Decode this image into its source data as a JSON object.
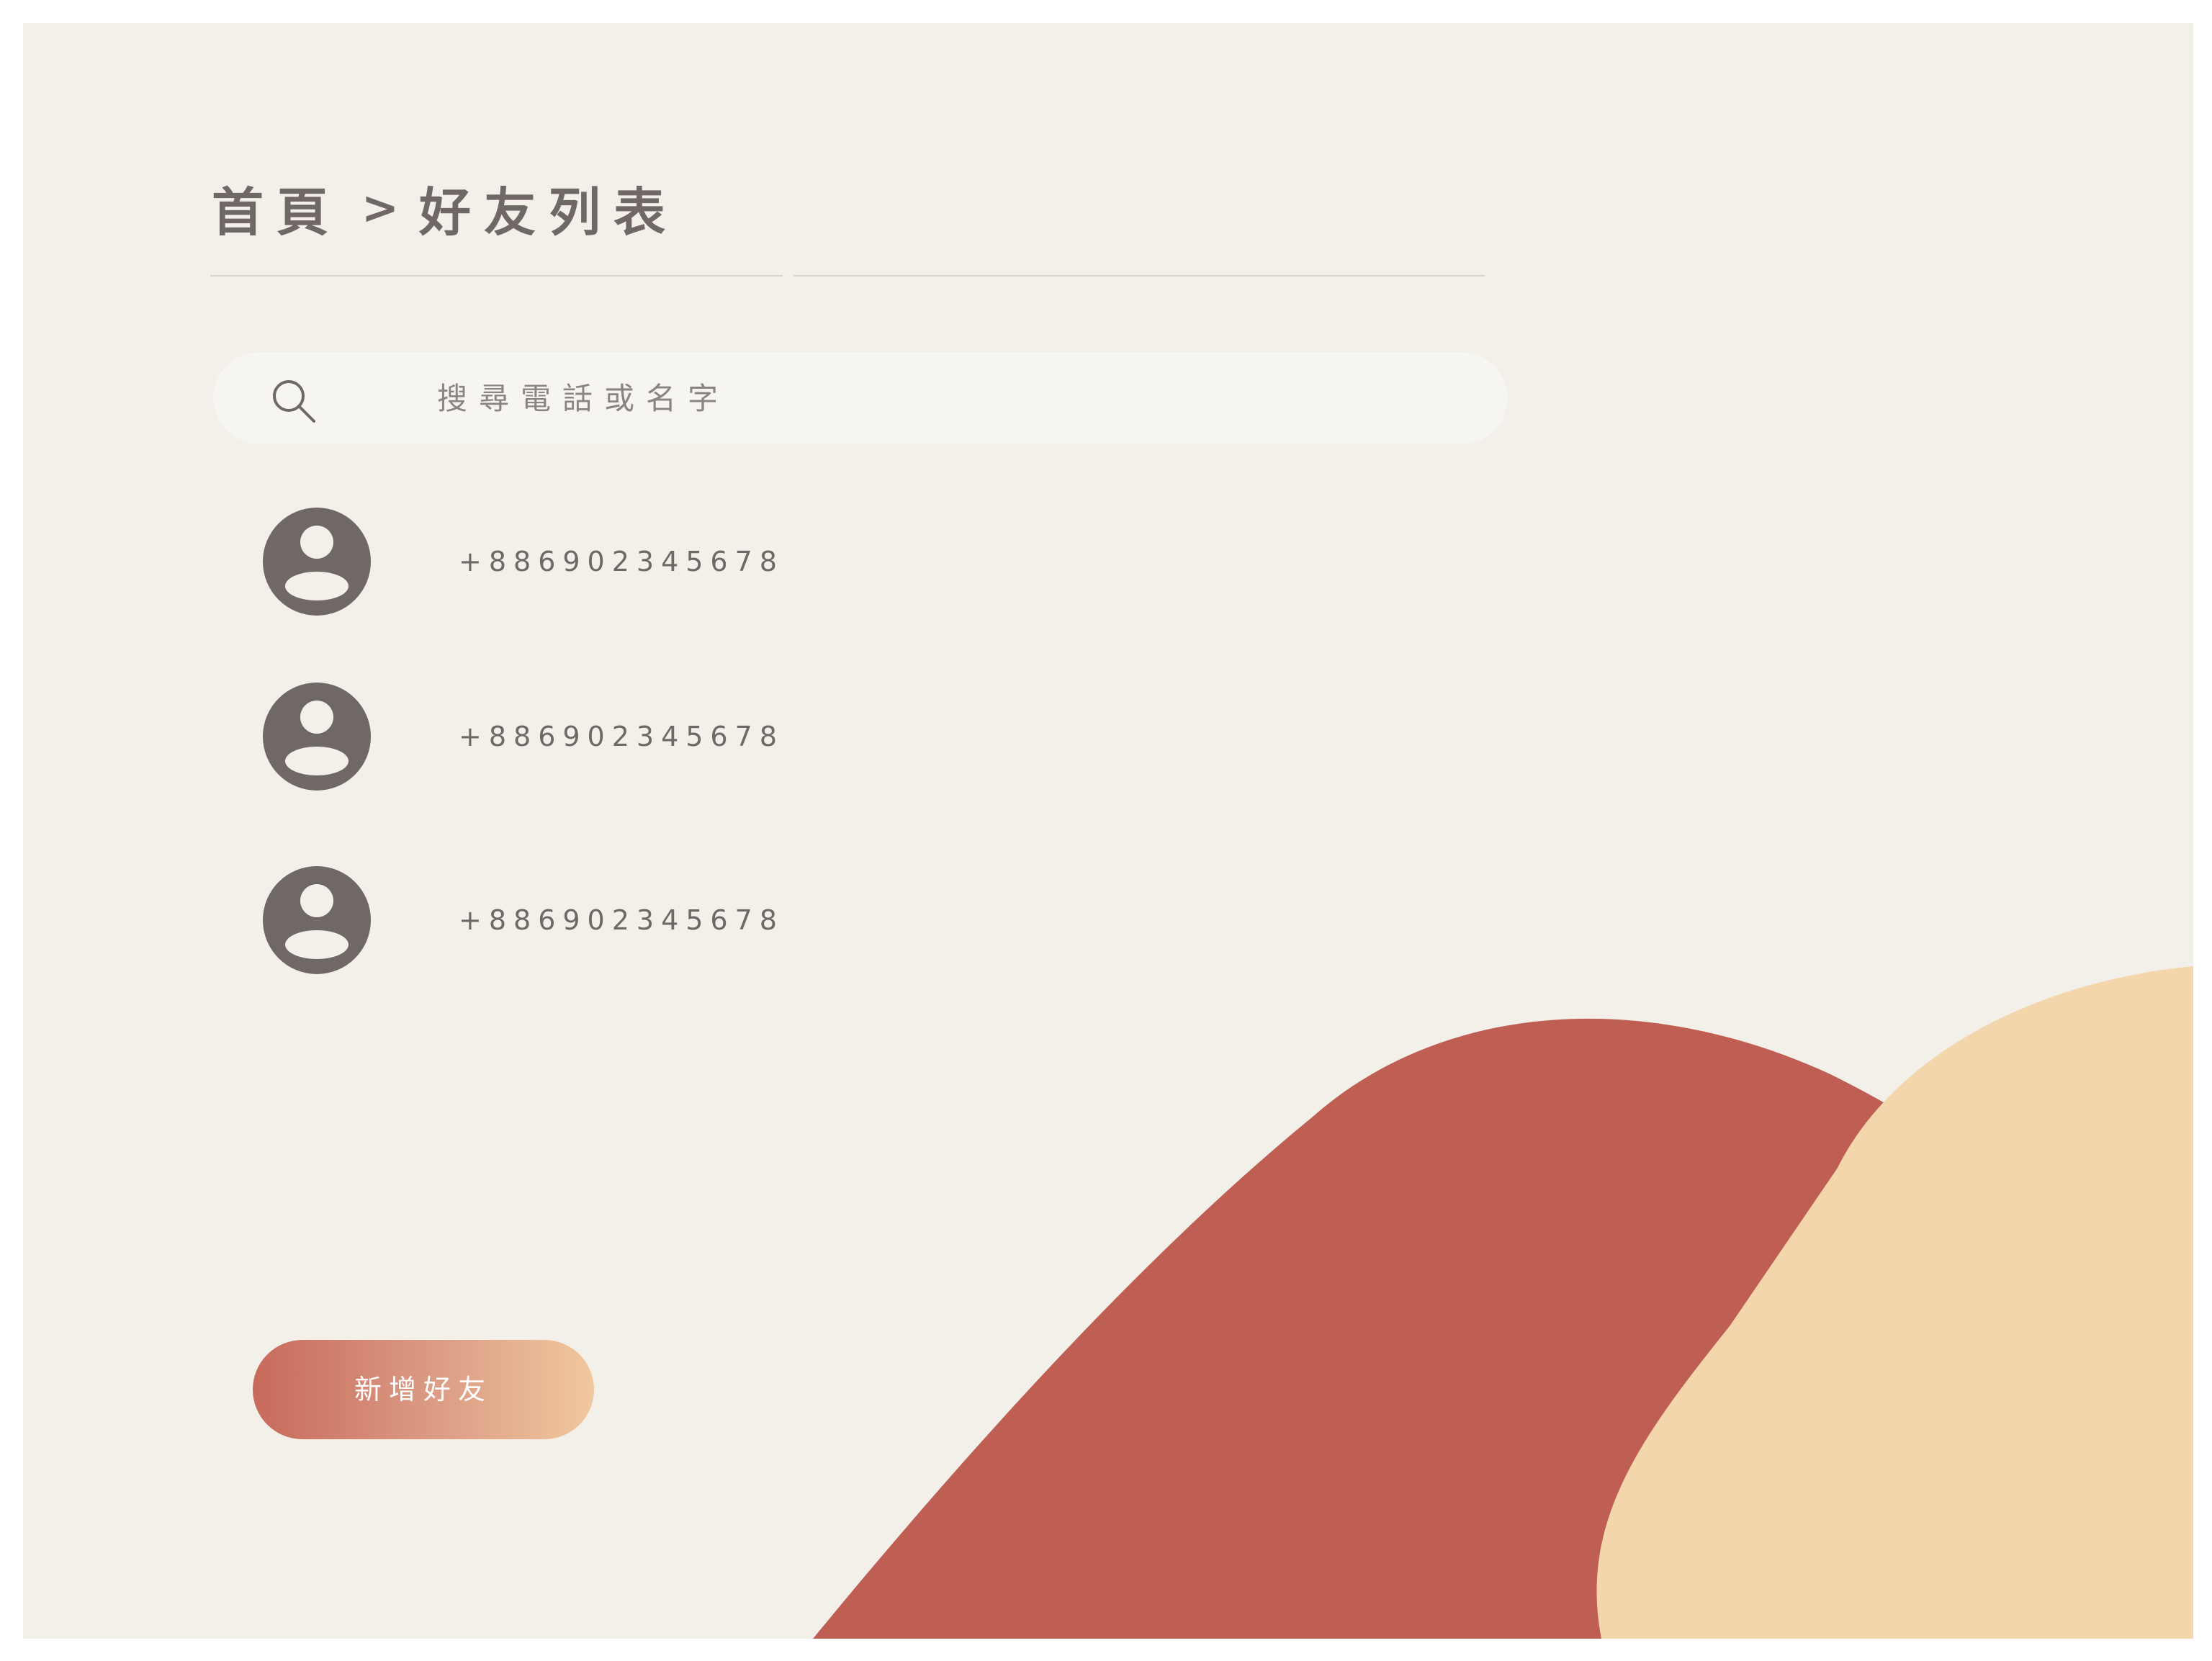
{
  "breadcrumb": {
    "home": "首頁",
    "separator": ">",
    "current": "好友列表"
  },
  "search": {
    "placeholder": "搜尋電話或名字",
    "icon": "search-icon"
  },
  "friends": [
    {
      "phone": "+886902345678",
      "avatar_icon": "user-avatar-icon"
    },
    {
      "phone": "+886902345678",
      "avatar_icon": "user-avatar-icon"
    },
    {
      "phone": "+886902345678",
      "avatar_icon": "user-avatar-icon"
    }
  ],
  "actions": {
    "add_friend_label": "新增好友"
  },
  "colors": {
    "background": "#f3f0ea",
    "text": "#6f6866",
    "accent_red": "#bf5f53",
    "accent_peach": "#f4d6ac",
    "button_gradient_start": "#c76a5b",
    "button_gradient_end": "#f0c89e"
  }
}
